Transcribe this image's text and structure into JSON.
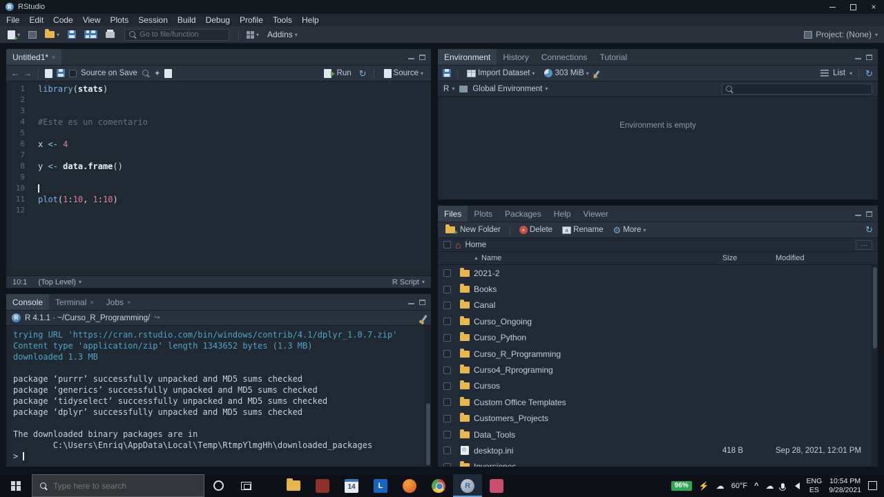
{
  "titlebar": {
    "title": "RStudio"
  },
  "menubar": {
    "items": [
      "File",
      "Edit",
      "Code",
      "View",
      "Plots",
      "Session",
      "Build",
      "Debug",
      "Profile",
      "Tools",
      "Help"
    ]
  },
  "toolbar": {
    "goto_placeholder": "Go to file/function",
    "addins_label": "Addins",
    "project_label": "Project: (None)"
  },
  "source_pane": {
    "tabs": [
      {
        "label": "Untitled1*",
        "active": true,
        "closable": true
      }
    ],
    "source_on_save": "Source on Save",
    "run_label": "Run",
    "source_label": "Source",
    "status_position": "10:1",
    "status_scope": "(Top Level)",
    "status_type": "R Script",
    "code_lines": [
      {
        "n": "1",
        "tokens": [
          {
            "t": "library",
            "c": "fn"
          },
          {
            "t": "(",
            "c": "pl"
          },
          {
            "t": "stats",
            "c": "id"
          },
          {
            "t": ")",
            "c": "pl"
          }
        ]
      },
      {
        "n": "2",
        "tokens": []
      },
      {
        "n": "3",
        "tokens": []
      },
      {
        "n": "4",
        "tokens": [
          {
            "t": "#Este es un comentario",
            "c": "comment"
          }
        ]
      },
      {
        "n": "5",
        "tokens": []
      },
      {
        "n": "6",
        "tokens": [
          {
            "t": "x ",
            "c": "pl"
          },
          {
            "t": "<-",
            "c": "op"
          },
          {
            "t": " ",
            "c": "pl"
          },
          {
            "t": "4",
            "c": "num"
          }
        ]
      },
      {
        "n": "7",
        "tokens": []
      },
      {
        "n": "8",
        "tokens": [
          {
            "t": "y ",
            "c": "pl"
          },
          {
            "t": "<-",
            "c": "op"
          },
          {
            "t": " ",
            "c": "pl"
          },
          {
            "t": "data.frame",
            "c": "id"
          },
          {
            "t": "()",
            "c": "pl"
          }
        ]
      },
      {
        "n": "9",
        "tokens": []
      },
      {
        "n": "10",
        "tokens": [],
        "cursor": true
      },
      {
        "n": "11",
        "tokens": [
          {
            "t": "plot",
            "c": "fn"
          },
          {
            "t": "(",
            "c": "pl"
          },
          {
            "t": "1",
            "c": "num"
          },
          {
            "t": ":",
            "c": "pl"
          },
          {
            "t": "10",
            "c": "num"
          },
          {
            "t": ", ",
            "c": "pl"
          },
          {
            "t": "1",
            "c": "num"
          },
          {
            "t": ":",
            "c": "pl"
          },
          {
            "t": "10",
            "c": "num"
          },
          {
            "t": ")",
            "c": "pl"
          }
        ]
      },
      {
        "n": "12",
        "tokens": []
      }
    ]
  },
  "console_pane": {
    "tabs": [
      {
        "label": "Console",
        "active": true,
        "closable": false
      },
      {
        "label": "Terminal",
        "active": false,
        "closable": true
      },
      {
        "label": "Jobs",
        "active": false,
        "closable": true
      }
    ],
    "header": "R 4.1.1 · ~/Curso_R_Programming/",
    "lines": [
      {
        "text": "trying URL 'https://cran.rstudio.com/bin/windows/contrib/4.1/dplyr_1.0.7.zip'",
        "cls": "info"
      },
      {
        "text": "Content type 'application/zip' length 1343652 bytes (1.3 MB)",
        "cls": "info"
      },
      {
        "text": "downloaded 1.3 MB",
        "cls": "info"
      },
      {
        "text": "",
        "cls": "out"
      },
      {
        "text": "package ‘purrr’ successfully unpacked and MD5 sums checked",
        "cls": "out"
      },
      {
        "text": "package ‘generics’ successfully unpacked and MD5 sums checked",
        "cls": "out"
      },
      {
        "text": "package ‘tidyselect’ successfully unpacked and MD5 sums checked",
        "cls": "out"
      },
      {
        "text": "package ‘dplyr’ successfully unpacked and MD5 sums checked",
        "cls": "out"
      },
      {
        "text": "",
        "cls": "out"
      },
      {
        "text": "The downloaded binary packages are in",
        "cls": "out"
      },
      {
        "text": "        C:\\Users\\Enriq\\AppData\\Local\\Temp\\RtmpYlmgHh\\downloaded_packages",
        "cls": "out"
      }
    ],
    "prompt": ">"
  },
  "environment_pane": {
    "tabs": [
      {
        "label": "Environment",
        "active": true,
        "closable": false
      },
      {
        "label": "History",
        "active": false,
        "closable": false
      },
      {
        "label": "Connections",
        "active": false,
        "closable": false
      },
      {
        "label": "Tutorial",
        "active": false,
        "closable": false
      }
    ],
    "import_label": "Import Dataset",
    "memory_label": "303 MiB",
    "list_label": "List",
    "lang_label": "R",
    "env_label": "Global Environment",
    "empty_message": "Environment is empty"
  },
  "files_pane": {
    "tabs": [
      {
        "label": "Files",
        "active": true,
        "closable": false
      },
      {
        "label": "Plots",
        "active": false,
        "closable": false
      },
      {
        "label": "Packages",
        "active": false,
        "closable": false
      },
      {
        "label": "Help",
        "active": false,
        "closable": false
      },
      {
        "label": "Viewer",
        "active": false,
        "closable": false
      }
    ],
    "new_folder_label": "New Folder",
    "delete_label": "Delete",
    "rename_label": "Rename",
    "more_label": "More",
    "breadcrumb": "Home",
    "columns": {
      "name": "Name",
      "size": "Size",
      "modified": "Modified"
    },
    "rows": [
      {
        "name": "2021-2",
        "type": "folder",
        "size": "",
        "modified": ""
      },
      {
        "name": "Books",
        "type": "folder",
        "size": "",
        "modified": ""
      },
      {
        "name": "Canal",
        "type": "folder",
        "size": "",
        "modified": ""
      },
      {
        "name": "Curso_Ongoing",
        "type": "folder",
        "size": "",
        "modified": ""
      },
      {
        "name": "Curso_Python",
        "type": "folder",
        "size": "",
        "modified": ""
      },
      {
        "name": "Curso_R_Programming",
        "type": "folder",
        "size": "",
        "modified": ""
      },
      {
        "name": "Curso4_Rprograming",
        "type": "folder",
        "size": "",
        "modified": ""
      },
      {
        "name": "Cursos",
        "type": "folder",
        "size": "",
        "modified": ""
      },
      {
        "name": "Custom Office Templates",
        "type": "folder",
        "size": "",
        "modified": ""
      },
      {
        "name": "Customers_Projects",
        "type": "folder",
        "size": "",
        "modified": ""
      },
      {
        "name": "Data_Tools",
        "type": "folder",
        "size": "",
        "modified": ""
      },
      {
        "name": "desktop.ini",
        "type": "file",
        "size": "418 B",
        "modified": "Sep 28, 2021, 12:01 PM"
      },
      {
        "name": "Inversiones",
        "type": "folder",
        "size": "",
        "modified": ""
      }
    ]
  },
  "taskbar": {
    "search_placeholder": "Type here to search",
    "apps": [
      {
        "id": "file-explorer",
        "label": ""
      },
      {
        "id": "app-maroon",
        "label": ""
      },
      {
        "id": "calendar",
        "label": "14"
      },
      {
        "id": "l-app",
        "label": "L"
      },
      {
        "id": "firefox",
        "label": ""
      },
      {
        "id": "chrome",
        "label": ""
      },
      {
        "id": "rstudio",
        "label": "R",
        "active": true
      },
      {
        "id": "app-pink",
        "label": ""
      }
    ],
    "battery": "96%",
    "temperature": "60°F",
    "lang_primary": "ENG",
    "lang_secondary": "ES",
    "time": "10:54 PM",
    "date": "9/28/2021"
  }
}
